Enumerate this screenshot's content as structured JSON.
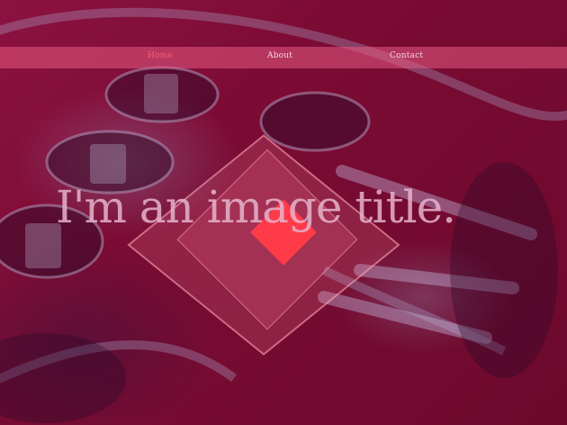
{
  "nav": {
    "items": [
      {
        "label": "Home",
        "active": true
      },
      {
        "label": "About",
        "active": false
      },
      {
        "label": "Contact",
        "active": false
      }
    ]
  },
  "hero": {
    "title": "I'm an image title."
  },
  "colors": {
    "overlay": "#7a0a2e",
    "nav_bar": "#e65a82",
    "nav_active": "#ff5b6a",
    "accent": "#ff3b4a"
  }
}
